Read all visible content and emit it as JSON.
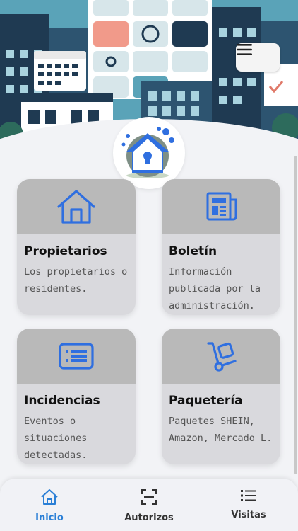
{
  "header": {
    "menu_icon": "hamburger-menu-icon"
  },
  "logo": {
    "icon": "house-lock-logo-icon"
  },
  "cards": [
    {
      "title": "Propietarios",
      "description": "Los propietarios o residentes.",
      "icon": "house-icon"
    },
    {
      "title": "Boletín",
      "description": "Información publicada por la administración.",
      "icon": "newspaper-icon"
    },
    {
      "title": "Incidencias",
      "description": "Eventos o situaciones detectadas.",
      "icon": "report-list-icon"
    },
    {
      "title": "Paquetería",
      "description": "Paquetes SHEIN, Amazon, Mercado L.",
      "icon": "hand-truck-icon"
    }
  ],
  "bottom_nav": [
    {
      "label": "Inicio",
      "icon": "home-icon",
      "active": true
    },
    {
      "label": "Autorizos",
      "icon": "scan-icon",
      "active": false
    },
    {
      "label": "Visitas",
      "icon": "list-icon",
      "active": false
    }
  ],
  "colors": {
    "accent": "#2a7fd6",
    "icon_blue": "#2f6fe0",
    "card_top": "#b9b9b9",
    "card_body": "#d9d9dd"
  }
}
